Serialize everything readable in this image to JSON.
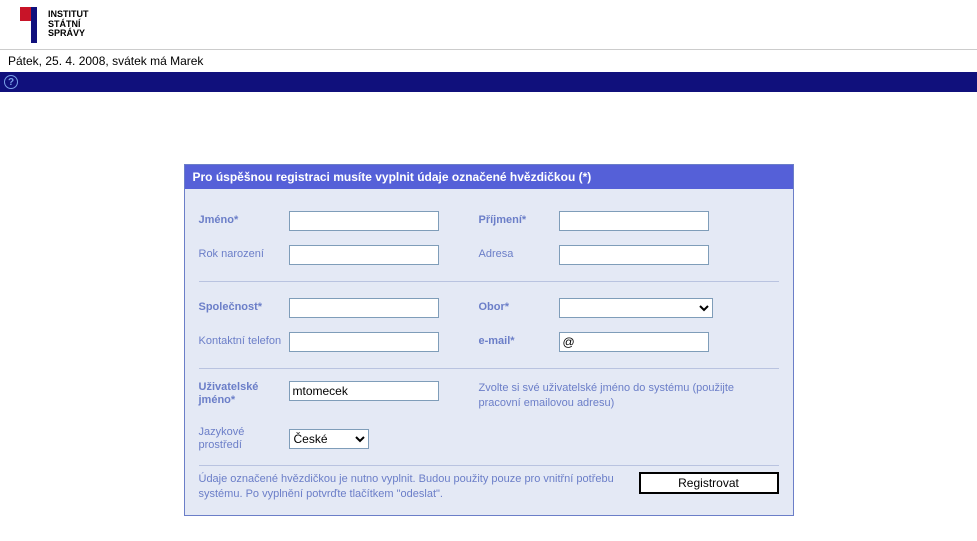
{
  "header": {
    "logo_lines": [
      "Institut",
      "Státní",
      "Správy"
    ]
  },
  "status_bar": "Pátek, 25. 4. 2008, svátek má Marek",
  "help_glyph": "?",
  "form": {
    "title": "Pro úspěšnou registraci musíte vyplnit údaje označené hvězdičkou (*)",
    "labels": {
      "first_name": "Jméno*",
      "last_name": "Příjmení*",
      "birth_year": "Rok narození",
      "address": "Adresa",
      "company": "Společnost*",
      "field": "Obor*",
      "phone": "Kontaktní telefon",
      "email": "e-mail*",
      "username": "Uživatelské jméno*",
      "locale": "Jazykové prostředí"
    },
    "values": {
      "first_name": "",
      "last_name": "",
      "birth_year": "",
      "address": "",
      "company": "",
      "field_selected": "",
      "phone": "",
      "email": "@",
      "username": "mtomecek",
      "locale_selected": "České"
    },
    "username_hint": "Zvolte si své uživatelské jméno do systému (použijte pracovní emailovou adresu)",
    "footer_note": "Údaje označené hvězdičkou je nutno vyplnit. Budou použity pouze pro vnitřní potřebu systému. Po vyplnění potvrďte tlačítkem \"odeslat\".",
    "submit_label": "Registrovat"
  }
}
